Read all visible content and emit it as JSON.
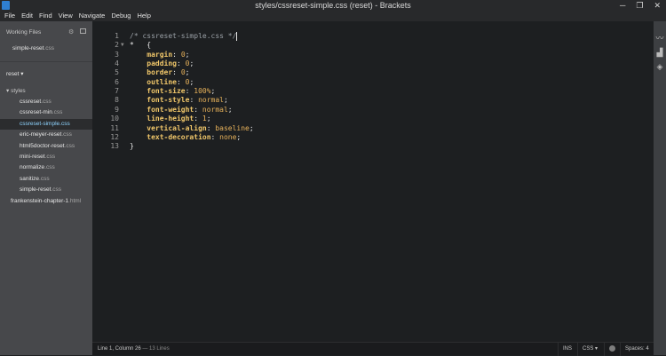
{
  "window": {
    "title": "styles/cssreset-simple.css (reset) - Brackets",
    "minimize": "─",
    "maximize": "❐",
    "close": "✕"
  },
  "menu": [
    "File",
    "Edit",
    "Find",
    "View",
    "Navigate",
    "Debug",
    "Help"
  ],
  "sidebar": {
    "working_files_header": "Working Files",
    "working_file": {
      "name": "simple-reset",
      "ext": ".css"
    },
    "project_title": "reset ▾",
    "folder": "▾ styles",
    "files": [
      {
        "name": "cssreset",
        "ext": ".css"
      },
      {
        "name": "cssreset-min",
        "ext": ".css"
      },
      {
        "name": "cssreset-simple",
        "ext": ".css"
      },
      {
        "name": "eric-meyer-reset",
        "ext": ".css"
      },
      {
        "name": "html5doctor-reset",
        "ext": ".css"
      },
      {
        "name": "mini-reset",
        "ext": ".css"
      },
      {
        "name": "normalize",
        "ext": ".css"
      },
      {
        "name": "sanitize",
        "ext": ".css"
      },
      {
        "name": "simple-reset",
        "ext": ".css"
      }
    ],
    "root_file": {
      "name": "frankenstein-chapter-1",
      "ext": ".html"
    },
    "selected_index": 2
  },
  "editor": {
    "lines": [
      {
        "num": "1",
        "parts": [
          {
            "t": "/* cssreset-simple.css */",
            "c": "c-comment"
          }
        ],
        "caret": true
      },
      {
        "num": "2",
        "fold": "▼",
        "parts": [
          {
            "t": "*   {",
            "c": "c-plain"
          }
        ]
      },
      {
        "num": "3",
        "parts": [
          {
            "t": "    margin",
            "c": "c-prop"
          },
          {
            "t": ": ",
            "c": "c-plain"
          },
          {
            "t": "0",
            "c": "c-val"
          },
          {
            "t": ";",
            "c": "c-plain"
          }
        ]
      },
      {
        "num": "4",
        "parts": [
          {
            "t": "    padding",
            "c": "c-prop"
          },
          {
            "t": ": ",
            "c": "c-plain"
          },
          {
            "t": "0",
            "c": "c-val"
          },
          {
            "t": ";",
            "c": "c-plain"
          }
        ]
      },
      {
        "num": "5",
        "parts": [
          {
            "t": "    border",
            "c": "c-prop"
          },
          {
            "t": ": ",
            "c": "c-plain"
          },
          {
            "t": "0",
            "c": "c-val"
          },
          {
            "t": ";",
            "c": "c-plain"
          }
        ]
      },
      {
        "num": "6",
        "parts": [
          {
            "t": "    outline",
            "c": "c-prop"
          },
          {
            "t": ": ",
            "c": "c-plain"
          },
          {
            "t": "0",
            "c": "c-val"
          },
          {
            "t": ";",
            "c": "c-plain"
          }
        ]
      },
      {
        "num": "7",
        "parts": [
          {
            "t": "    font-size",
            "c": "c-prop"
          },
          {
            "t": ": ",
            "c": "c-plain"
          },
          {
            "t": "100%",
            "c": "c-val"
          },
          {
            "t": ";",
            "c": "c-plain"
          }
        ]
      },
      {
        "num": "8",
        "parts": [
          {
            "t": "    font-style",
            "c": "c-prop"
          },
          {
            "t": ": ",
            "c": "c-plain"
          },
          {
            "t": "normal",
            "c": "c-val"
          },
          {
            "t": ";",
            "c": "c-plain"
          }
        ]
      },
      {
        "num": "9",
        "parts": [
          {
            "t": "    font-weight",
            "c": "c-prop"
          },
          {
            "t": ": ",
            "c": "c-plain"
          },
          {
            "t": "normal",
            "c": "c-val"
          },
          {
            "t": ";",
            "c": "c-plain"
          }
        ]
      },
      {
        "num": "10",
        "parts": [
          {
            "t": "    line-height",
            "c": "c-prop"
          },
          {
            "t": ": ",
            "c": "c-plain"
          },
          {
            "t": "1",
            "c": "c-val"
          },
          {
            "t": ";",
            "c": "c-plain"
          }
        ]
      },
      {
        "num": "11",
        "parts": [
          {
            "t": "    vertical-align",
            "c": "c-prop"
          },
          {
            "t": ": ",
            "c": "c-plain"
          },
          {
            "t": "baseline",
            "c": "c-val"
          },
          {
            "t": ";",
            "c": "c-plain"
          }
        ]
      },
      {
        "num": "12",
        "parts": [
          {
            "t": "    text-decoration",
            "c": "c-prop"
          },
          {
            "t": ": ",
            "c": "c-plain"
          },
          {
            "t": "none",
            "c": "c-val"
          },
          {
            "t": ";",
            "c": "c-plain"
          }
        ]
      },
      {
        "num": "13",
        "parts": [
          {
            "t": "}",
            "c": "c-plain"
          }
        ]
      }
    ]
  },
  "statusbar": {
    "cursor": "Line 1, Column 26",
    "lines": " — 13 Lines",
    "mode": "INS",
    "language": "CSS ▾",
    "spaces": "Spaces: 4"
  },
  "rightbar_icons": [
    "live-preview-icon",
    "extension-manager-icon",
    "layers-icon"
  ]
}
